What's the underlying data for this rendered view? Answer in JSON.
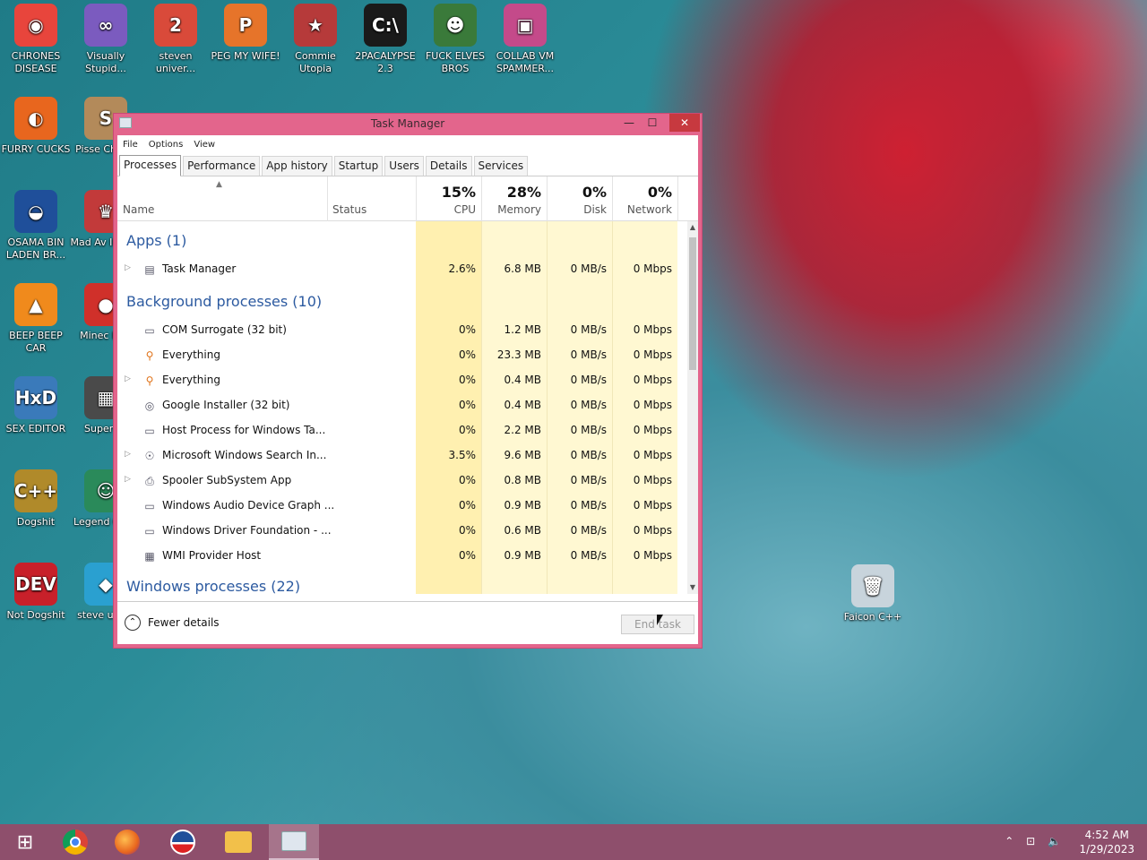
{
  "desktop": {
    "icons": [
      {
        "label": "CHRONES DISEASE",
        "icon": "chrome-icon",
        "color": "#e8453c",
        "glyph": "◉"
      },
      {
        "label": "Visually Stupid...",
        "icon": "visual-studio-icon",
        "color": "#7b5bbf",
        "glyph": "∞"
      },
      {
        "label": "steven univer...",
        "icon": "steven-universe-icon",
        "color": "#d94a3a",
        "glyph": "2"
      },
      {
        "label": "PEG MY WIFE!",
        "icon": "peg-icon",
        "color": "#e6742a",
        "glyph": "P"
      },
      {
        "label": "Commie Utopia",
        "icon": "commie-icon",
        "color": "#b63a3a",
        "glyph": "★"
      },
      {
        "label": "2PACALYPSE 2.3",
        "icon": "cmd-icon",
        "color": "#1a1a1a",
        "glyph": "C:\\"
      },
      {
        "label": "FUCK ELVES BROS",
        "icon": "elf-icon",
        "color": "#3a7a3a",
        "glyph": "☻"
      },
      {
        "label": "COLLAB VM SPAMMER...",
        "icon": "collab-vm-icon",
        "color": "#c44a8a",
        "glyph": "▣"
      },
      {
        "label": "FURRY CUCKS",
        "icon": "firefox-icon",
        "color": "#e8661e",
        "glyph": "◐"
      },
      {
        "label": "Pisse Chicke",
        "icon": "pisse-icon",
        "color": "#b38a5a",
        "glyph": "S"
      },
      {
        "label": "OSAMA BIN LADEN BR...",
        "icon": "obama-icon",
        "color": "#1f4f9a",
        "glyph": "◒"
      },
      {
        "label": "Mad Av IN SPA",
        "icon": "game-icon",
        "color": "#c23a3a",
        "glyph": "♛"
      },
      {
        "label": "BEEP BEEP CAR",
        "icon": "vlc-icon",
        "color": "#f08a1c",
        "glyph": "▲"
      },
      {
        "label": "Minec Bird",
        "icon": "angry-bird-icon",
        "color": "#d0302a",
        "glyph": "●"
      },
      {
        "label": "SEX EDITOR",
        "icon": "hxd-icon",
        "color": "#3a7aba",
        "glyph": "HxD"
      },
      {
        "label": "Super Cr",
        "icon": "qr-icon",
        "color": "#4a4a4a",
        "glyph": "▦"
      },
      {
        "label": "Dogshit",
        "icon": "dogshit-icon",
        "color": "#b08a2a",
        "glyph": "C++"
      },
      {
        "label": "Legend CRYA",
        "icon": "legend-icon",
        "color": "#2a8a5a",
        "glyph": "☺"
      },
      {
        "label": "Not Dogshit",
        "icon": "devcpp-icon",
        "color": "#c8202a",
        "glyph": "DEV"
      },
      {
        "label": "steve unive",
        "icon": "diamond-icon",
        "color": "#2aa0d0",
        "glyph": "◆"
      },
      {
        "label": "Faicon C++",
        "icon": "recycle-bin-icon",
        "color": "#c8d4dc",
        "glyph": "🗑"
      }
    ]
  },
  "taskmanager": {
    "title": "Task Manager",
    "menu": [
      "File",
      "Options",
      "View"
    ],
    "tabs": [
      "Processes",
      "Performance",
      "App history",
      "Startup",
      "Users",
      "Details",
      "Services"
    ],
    "active_tab": "Processes",
    "headers": {
      "name": "Name",
      "status": "Status",
      "cpu_pct": "15%",
      "cpu": "CPU",
      "mem_pct": "28%",
      "mem": "Memory",
      "disk_pct": "0%",
      "disk": "Disk",
      "net_pct": "0%",
      "net": "Network"
    },
    "groups": {
      "apps": "Apps (1)",
      "background": "Background processes (10)",
      "windows": "Windows processes (22)"
    },
    "apps": [
      {
        "name": "Task Manager",
        "icon": "task-manager-icon",
        "expand": true,
        "cpu": "2.6%",
        "mem": "6.8 MB",
        "disk": "0 MB/s",
        "net": "0 Mbps"
      }
    ],
    "background": [
      {
        "name": "COM Surrogate (32 bit)",
        "icon": "window-icon",
        "expand": false,
        "cpu": "0%",
        "mem": "1.2 MB",
        "disk": "0 MB/s",
        "net": "0 Mbps"
      },
      {
        "name": "Everything",
        "icon": "search-icon",
        "expand": false,
        "cpu": "0%",
        "mem": "23.3 MB",
        "disk": "0 MB/s",
        "net": "0 Mbps"
      },
      {
        "name": "Everything",
        "icon": "search-icon",
        "expand": true,
        "cpu": "0%",
        "mem": "0.4 MB",
        "disk": "0 MB/s",
        "net": "0 Mbps"
      },
      {
        "name": "Google Installer (32 bit)",
        "icon": "installer-icon",
        "expand": false,
        "cpu": "0%",
        "mem": "0.4 MB",
        "disk": "0 MB/s",
        "net": "0 Mbps"
      },
      {
        "name": "Host Process for Windows Ta...",
        "icon": "window-icon",
        "expand": false,
        "cpu": "0%",
        "mem": "2.2 MB",
        "disk": "0 MB/s",
        "net": "0 Mbps"
      },
      {
        "name": "Microsoft Windows Search In...",
        "icon": "user-search-icon",
        "expand": true,
        "cpu": "3.5%",
        "mem": "9.6 MB",
        "disk": "0 MB/s",
        "net": "0 Mbps"
      },
      {
        "name": "Spooler SubSystem App",
        "icon": "printer-icon",
        "expand": true,
        "cpu": "0%",
        "mem": "0.8 MB",
        "disk": "0 MB/s",
        "net": "0 Mbps"
      },
      {
        "name": "Windows Audio Device Graph ...",
        "icon": "window-icon",
        "expand": false,
        "cpu": "0%",
        "mem": "0.9 MB",
        "disk": "0 MB/s",
        "net": "0 Mbps"
      },
      {
        "name": "Windows Driver Foundation - ...",
        "icon": "window-icon",
        "expand": false,
        "cpu": "0%",
        "mem": "0.6 MB",
        "disk": "0 MB/s",
        "net": "0 Mbps"
      },
      {
        "name": "WMI Provider Host",
        "icon": "wmi-icon",
        "expand": false,
        "cpu": "0%",
        "mem": "0.9 MB",
        "disk": "0 MB/s",
        "net": "0 Mbps"
      }
    ],
    "footer": {
      "fewer_details": "Fewer details",
      "end_task": "End task"
    }
  },
  "taskbar": {
    "items": [
      "start-icon",
      "chrome-icon",
      "firefox-icon",
      "obama-icon",
      "file-explorer-icon",
      "task-manager-icon"
    ],
    "time": "4:52 AM",
    "date": "1/29/2023"
  }
}
